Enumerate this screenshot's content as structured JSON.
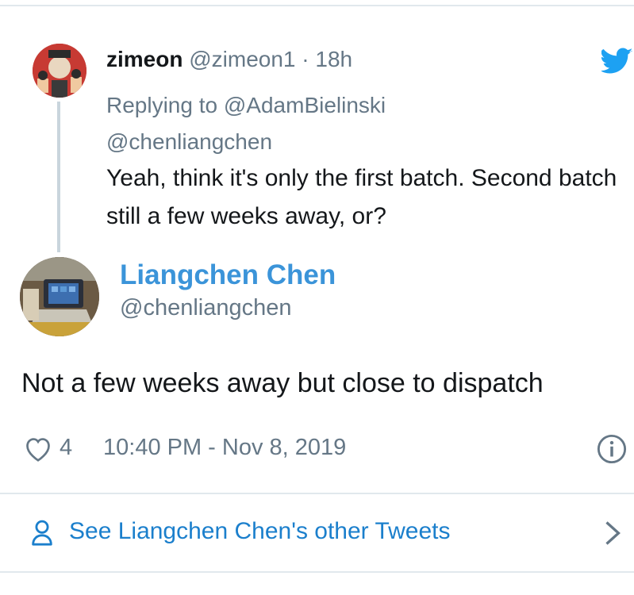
{
  "parent_tweet": {
    "name": "zimeon",
    "handle": "@zimeon1",
    "separator": "·",
    "time": "18h",
    "replying_prefix": "Replying to",
    "replying_to_1": "@AdamBielinski",
    "replying_to_2": "@chenliangchen",
    "text": "Yeah, think it's only the first batch. Second batch still a few weeks away, or?"
  },
  "tweet": {
    "name": "Liangchen Chen",
    "handle": "@chenliangchen",
    "text": "Not a few weeks away but close to dispatch",
    "like_count": "4",
    "timestamp": "10:40 PM - Nov 8, 2019"
  },
  "footer": {
    "see_others": "See Liangchen Chen's other Tweets"
  },
  "colors": {
    "link_blue": "#1b7fcc",
    "name_blue": "#3b94d9",
    "twitter_blue": "#1da1f2",
    "muted": "#657786"
  },
  "icons": [
    "twitter-bird-icon",
    "heart-icon",
    "info-icon",
    "person-icon",
    "chevron-right-icon"
  ]
}
